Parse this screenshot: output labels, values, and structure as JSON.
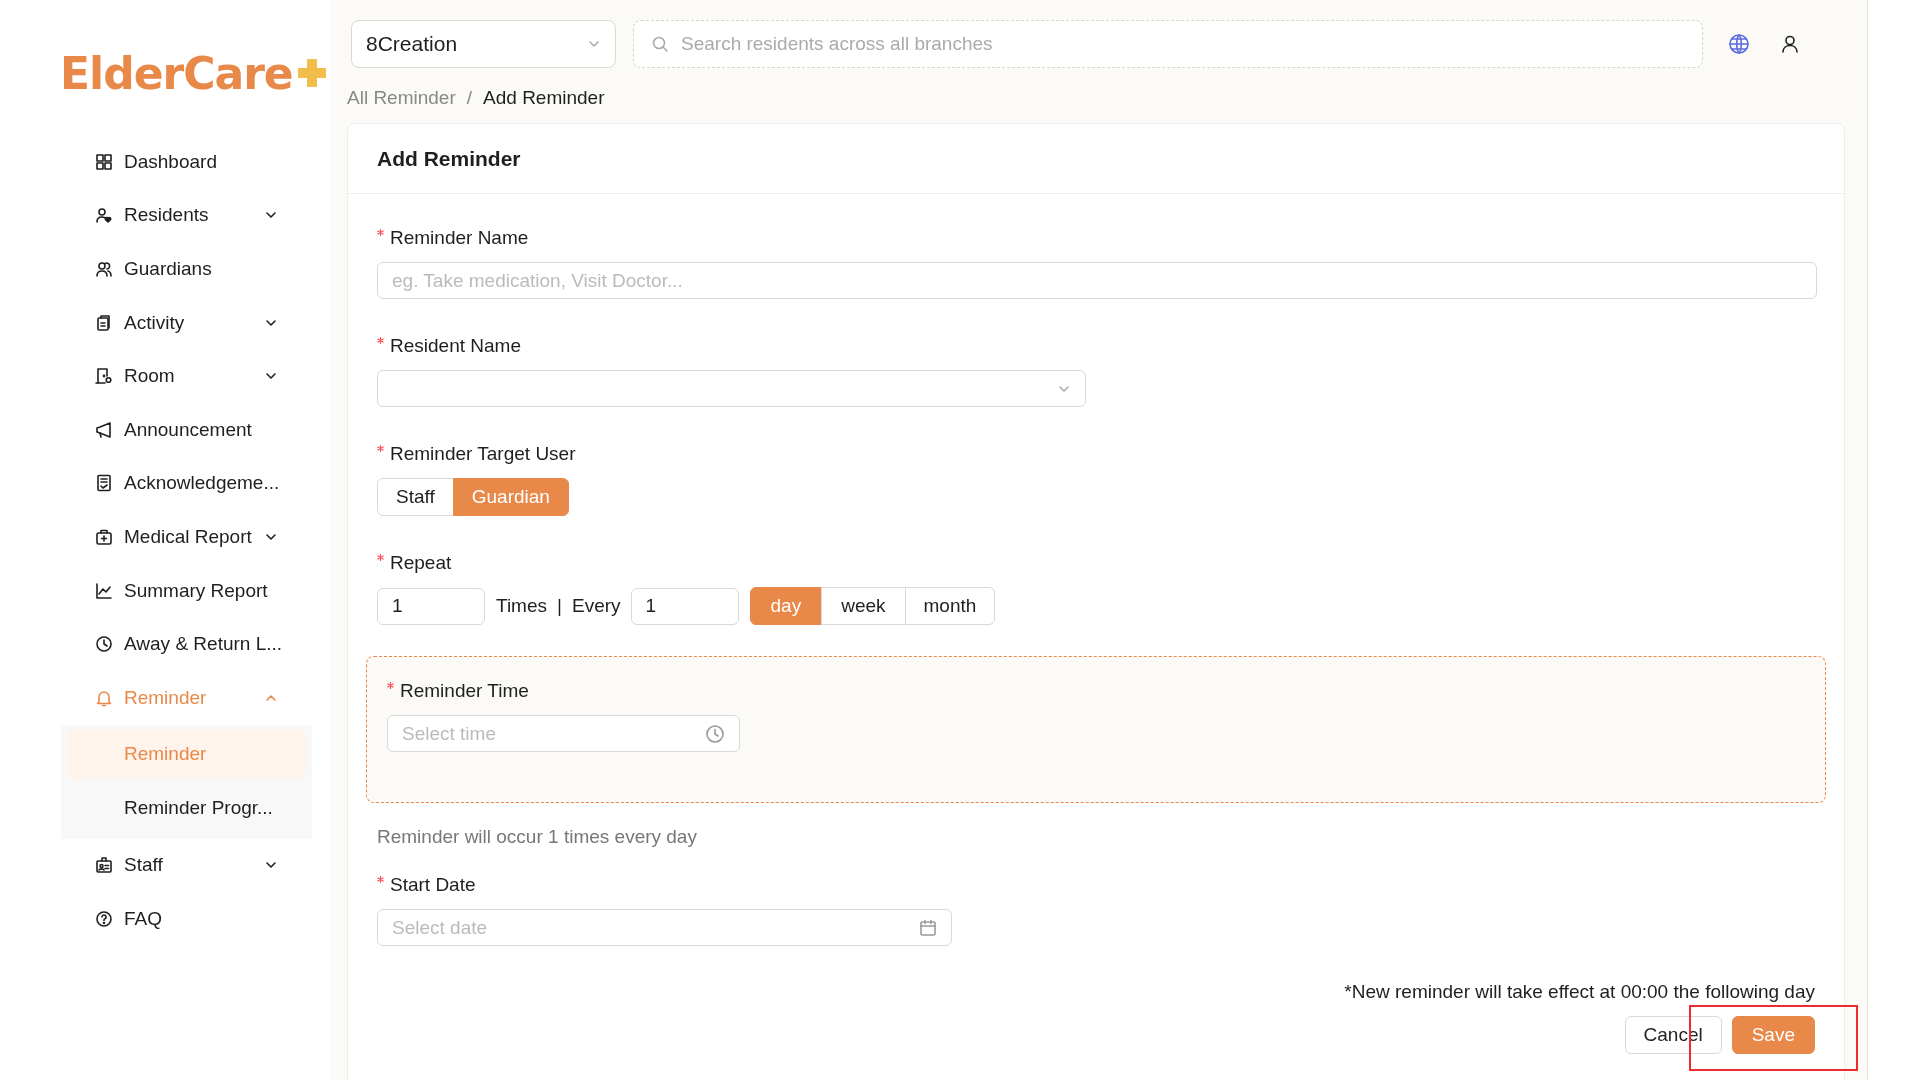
{
  "logo": {
    "text": "ElderCare"
  },
  "sidebar": {
    "items": [
      {
        "label": "Dashboard",
        "active": false
      },
      {
        "label": "Residents",
        "active": false,
        "expanded": false
      },
      {
        "label": "Guardians",
        "active": false
      },
      {
        "label": "Activity",
        "active": false,
        "expanded": false
      },
      {
        "label": "Room",
        "active": false,
        "expanded": false
      },
      {
        "label": "Announcement",
        "active": false
      },
      {
        "label": "Acknowledgeme...",
        "active": false
      },
      {
        "label": "Medical Report",
        "active": false,
        "expanded": false
      },
      {
        "label": "Summary Report",
        "active": false
      },
      {
        "label": "Away & Return L...",
        "active": false
      },
      {
        "label": "Reminder",
        "active": true,
        "expanded": true,
        "children": [
          {
            "label": "Reminder",
            "selected": true
          },
          {
            "label": "Reminder Progr...",
            "selected": false
          }
        ]
      },
      {
        "label": "Staff",
        "active": false,
        "expanded": false
      },
      {
        "label": "FAQ",
        "active": false
      }
    ]
  },
  "top_bar": {
    "branch_select": {
      "value": "8Creation"
    },
    "search": {
      "placeholder": "Search residents across all branches"
    }
  },
  "breadcrumb": {
    "separator": "/",
    "items": [
      {
        "label": "All Reminder",
        "current": false
      },
      {
        "label": "Add Reminder",
        "current": true
      }
    ]
  },
  "form": {
    "title": "Add Reminder",
    "fields": [
      {
        "kind": "text",
        "label": "Reminder Name",
        "required": true,
        "placeholder": "eg. Take medication, Visit Doctor..."
      },
      {
        "kind": "select",
        "label": "Resident Name",
        "required": true
      },
      {
        "kind": "segmented",
        "label": "Reminder Target User",
        "required": true,
        "options": [
          {
            "label": "Staff",
            "selected": false
          },
          {
            "label": "Guardian",
            "selected": true
          }
        ]
      },
      {
        "kind": "repeat",
        "label": "Repeat",
        "required": true,
        "times": "1",
        "times_label": "Times",
        "separator": "|",
        "every_label": "Every",
        "every": "1",
        "units": [
          {
            "label": "day",
            "selected": true
          },
          {
            "label": "week",
            "selected": false
          },
          {
            "label": "month",
            "selected": false
          }
        ]
      },
      {
        "kind": "time_group",
        "label": "Reminder Time",
        "required": true,
        "placeholder": "Select time"
      },
      {
        "kind": "info",
        "text": "Reminder will occur 1 times every day"
      },
      {
        "kind": "date",
        "label": "Start Date",
        "required": true,
        "placeholder": "Select date"
      }
    ],
    "note": "*New reminder will take effect at 00:00 the following day",
    "actions": [
      {
        "label": "Cancel",
        "kind": "default",
        "highlighted": false
      },
      {
        "label": "Save",
        "kind": "primary",
        "highlighted": true
      }
    ]
  }
}
